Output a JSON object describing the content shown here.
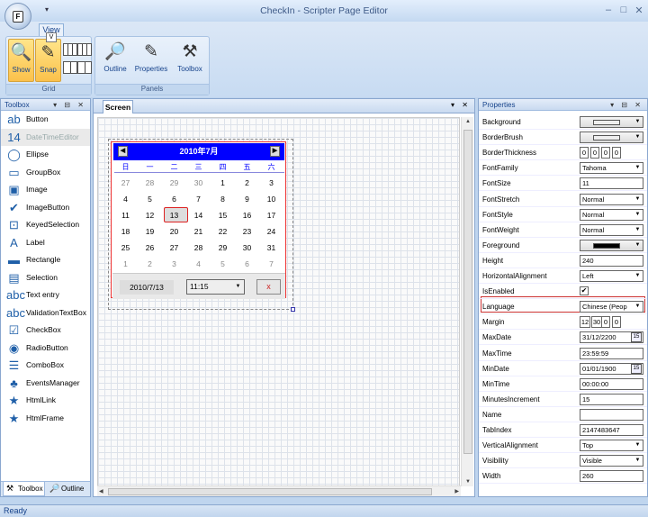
{
  "window": {
    "title": "CheckIn - Scripter Page Editor",
    "orb_letter": "F",
    "qat_label": "▾",
    "minimize": "–",
    "maximize": "□",
    "close": "✕"
  },
  "ribbon": {
    "active_tab": "View",
    "keytip": "V",
    "groups": [
      {
        "label": "Grid",
        "buttons": [
          {
            "label": "Show",
            "icon": "zoom-icon",
            "active": true
          },
          {
            "label": "Snap",
            "icon": "snap-icon",
            "active": true
          }
        ]
      },
      {
        "label": "Panels",
        "buttons": [
          {
            "label": "Outline",
            "icon": "magnifier-icon"
          },
          {
            "label": "Properties",
            "icon": "properties-icon"
          },
          {
            "label": "Toolbox",
            "icon": "tools-icon"
          }
        ]
      }
    ]
  },
  "toolbox": {
    "title": "Toolbox",
    "pane_buttons": "▾ ⊟ ✕",
    "items": [
      {
        "label": "Button",
        "icon": "ab"
      },
      {
        "label": "DateTimeEditor",
        "icon": "14",
        "selected": true
      },
      {
        "label": "Ellipse",
        "icon": "◯"
      },
      {
        "label": "GroupBox",
        "icon": "▭"
      },
      {
        "label": "Image",
        "icon": "▣"
      },
      {
        "label": "ImageButton",
        "icon": "✔"
      },
      {
        "label": "KeyedSelection",
        "icon": "⊡"
      },
      {
        "label": "Label",
        "icon": "A"
      },
      {
        "label": "Rectangle",
        "icon": "▬"
      },
      {
        "label": "Selection",
        "icon": "▤"
      },
      {
        "label": "Text entry",
        "icon": "abc"
      },
      {
        "label": "ValidationTextBox",
        "icon": "abc"
      },
      {
        "label": "CheckBox",
        "icon": "☑"
      },
      {
        "label": "RadioButton",
        "icon": "◉"
      },
      {
        "label": "ComboBox",
        "icon": "☰"
      },
      {
        "label": "EventsManager",
        "icon": "♣"
      },
      {
        "label": "HtmlLink",
        "icon": "★"
      },
      {
        "label": "HtmlFrame",
        "icon": "★"
      }
    ],
    "bottom_tabs": [
      "Toolbox",
      "Outline"
    ]
  },
  "document": {
    "tab": "Screen",
    "tab_buttons": "▾ ✕",
    "calendar": {
      "month_label": "2010年7月",
      "prev": "◀",
      "next": "▶",
      "weekdays": [
        "日",
        "一",
        "二",
        "三",
        "四",
        "五",
        "六"
      ],
      "weeks": [
        [
          "27",
          "28",
          "29",
          "30",
          "1",
          "2",
          "3"
        ],
        [
          "4",
          "5",
          "6",
          "7",
          "8",
          "9",
          "10"
        ],
        [
          "11",
          "12",
          "13",
          "14",
          "15",
          "16",
          "17"
        ],
        [
          "18",
          "19",
          "20",
          "21",
          "22",
          "23",
          "24"
        ],
        [
          "25",
          "26",
          "27",
          "28",
          "29",
          "30",
          "31"
        ],
        [
          "1",
          "2",
          "3",
          "4",
          "5",
          "6",
          "7"
        ]
      ],
      "selected_date": "13",
      "date_text": "2010/7/13",
      "time_text": "11:15",
      "clear_label": "x"
    }
  },
  "properties": {
    "title": "Properties",
    "rows": [
      {
        "name": "Background",
        "type": "brush"
      },
      {
        "name": "BorderBrush",
        "type": "brush"
      },
      {
        "name": "BorderThickness",
        "type": "thickness",
        "values": [
          "0",
          "0",
          "0",
          "0"
        ]
      },
      {
        "name": "FontFamily",
        "type": "combo",
        "value": "Tahoma"
      },
      {
        "name": "FontSize",
        "type": "text",
        "value": "11"
      },
      {
        "name": "FontStretch",
        "type": "combo",
        "value": "Normal"
      },
      {
        "name": "FontStyle",
        "type": "combo",
        "value": "Normal"
      },
      {
        "name": "FontWeight",
        "type": "combo",
        "value": "Normal"
      },
      {
        "name": "Foreground",
        "type": "brush-dark"
      },
      {
        "name": "Height",
        "type": "text",
        "value": "240"
      },
      {
        "name": "HorizontalAlignment",
        "type": "combo",
        "value": "Left"
      },
      {
        "name": "IsEnabled",
        "type": "check",
        "value": "✔"
      },
      {
        "name": "Language",
        "type": "combo",
        "value": "Chinese (Peop"
      },
      {
        "name": "Margin",
        "type": "thickness",
        "values": [
          "12",
          "30",
          "0",
          "0"
        ]
      },
      {
        "name": "MaxDate",
        "type": "date",
        "value": "31/12/2200"
      },
      {
        "name": "MaxTime",
        "type": "text",
        "value": "23:59:59"
      },
      {
        "name": "MinDate",
        "type": "date",
        "value": "01/01/1900"
      },
      {
        "name": "MinTime",
        "type": "text",
        "value": "00:00:00"
      },
      {
        "name": "MinutesIncrement",
        "type": "text",
        "value": "15"
      },
      {
        "name": "Name",
        "type": "text",
        "value": ""
      },
      {
        "name": "TabIndex",
        "type": "text",
        "value": "2147483647"
      },
      {
        "name": "VerticalAlignment",
        "type": "combo",
        "value": "Top"
      },
      {
        "name": "Visibility",
        "type": "combo",
        "value": "Visible"
      },
      {
        "name": "Width",
        "type": "text",
        "value": "260"
      }
    ],
    "calendar_icon_label": "15"
  },
  "status": {
    "text": "Ready"
  }
}
